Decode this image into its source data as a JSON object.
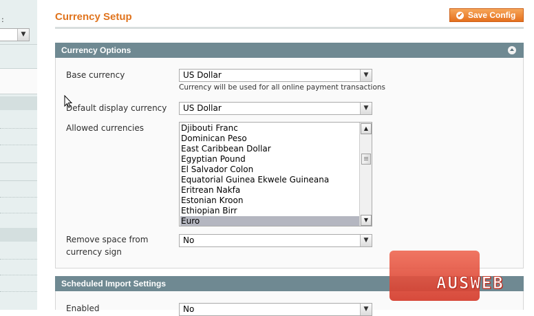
{
  "sidebar": {
    "scope_colon": ":"
  },
  "header": {
    "title": "Currency Setup",
    "save_label": "Save Config",
    "save_icon": "check-circle-icon"
  },
  "currency_options": {
    "title": "Currency Options",
    "collapse_icon": "collapse-up-icon",
    "base_currency": {
      "label": "Base currency",
      "value": "US Dollar",
      "note": "Currency will be used for all online payment transactions"
    },
    "default_display": {
      "label": "Default display currency",
      "value": "US Dollar"
    },
    "allowed": {
      "label": "Allowed currencies",
      "options": [
        "Djibouti Franc",
        "Dominican Peso",
        "East Caribbean Dollar",
        "Egyptian Pound",
        "El Salvador Colon",
        "Equatorial Guinea Ekwele Guineana",
        "Eritrean Nakfa",
        "Estonian Kroon",
        "Ethiopian Birr",
        "Euro"
      ],
      "selected": "Euro"
    },
    "remove_space": {
      "label_line1": "Remove space from",
      "label_line2": "currency sign",
      "value": "No"
    }
  },
  "scheduled_import": {
    "title": "Scheduled Import Settings",
    "enabled": {
      "label": "Enabled",
      "value": "No"
    }
  },
  "watermark": {
    "text": "AUSWEB"
  },
  "colors": {
    "accent": "#e0741e",
    "section_header": "#6f8992",
    "selected_option": "#b4b6c0"
  }
}
